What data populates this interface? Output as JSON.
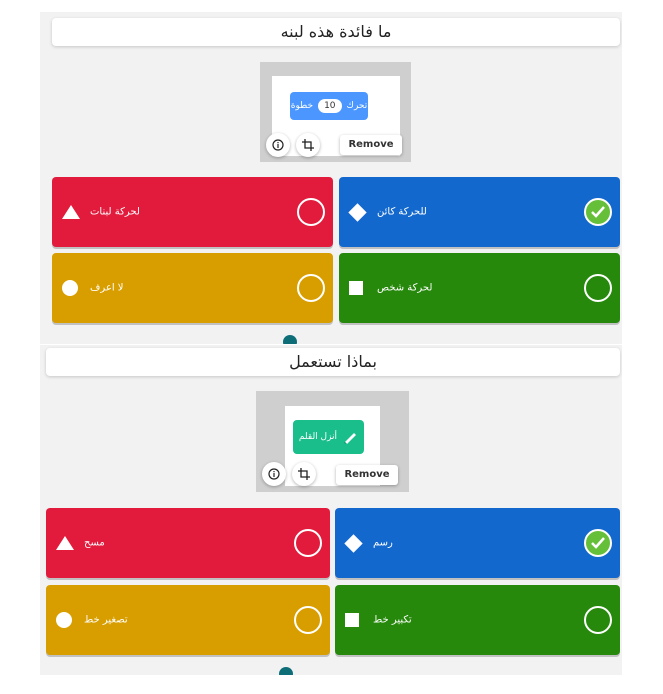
{
  "questions": [
    {
      "title": "ما فائدة هذه لبنه",
      "block": {
        "text": "تحرك",
        "value": "10",
        "unit": "خطوة"
      },
      "remove_label": "Remove",
      "info_icon": "info-icon",
      "crop_icon": "crop-icon",
      "answers": [
        {
          "label": "لحركة لبنات",
          "color": "#e21b3c",
          "shape": "triangle-icon",
          "correct": false
        },
        {
          "label": "للحركة كائن",
          "color": "#1368ce",
          "shape": "diamond-icon",
          "correct": true
        },
        {
          "label": "لا اعرف",
          "color": "#d89e00",
          "shape": "circle-icon",
          "correct": false
        },
        {
          "label": "لحركة شخص",
          "color": "#26890c",
          "shape": "square-icon",
          "correct": false
        }
      ]
    },
    {
      "title": "بماذا تستعمل",
      "block": {
        "text": "أنزل القلم",
        "icon": "pen-icon"
      },
      "remove_label": "Remove",
      "info_icon": "info-icon",
      "crop_icon": "crop-icon",
      "answers": [
        {
          "label": "مسح",
          "color": "#e21b3c",
          "shape": "triangle-icon",
          "correct": false
        },
        {
          "label": "رسم",
          "color": "#1368ce",
          "shape": "diamond-icon",
          "correct": true
        },
        {
          "label": "تصغير خط",
          "color": "#d89e00",
          "shape": "circle-icon",
          "correct": false
        },
        {
          "label": "تكبير خط",
          "color": "#26890c",
          "shape": "square-icon",
          "correct": false
        }
      ]
    }
  ]
}
